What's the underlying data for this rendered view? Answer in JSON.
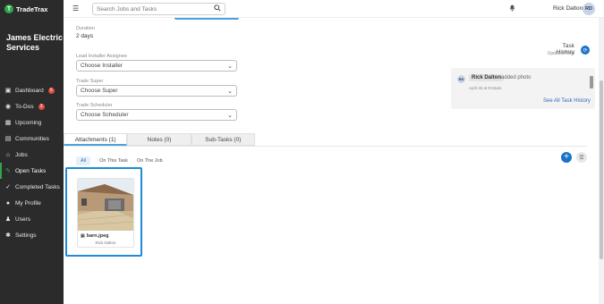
{
  "app": {
    "name": "TradeTrax",
    "logo_glyph": "T"
  },
  "sidebar": {
    "company": "James Electric Services",
    "items": [
      {
        "label": "Dashboard",
        "icon": "dashboard-icon",
        "glyph": "▣",
        "badge": "5",
        "active": false
      },
      {
        "label": "To-Dos",
        "icon": "todo-icon",
        "glyph": "◉",
        "badge": "3",
        "active": false
      },
      {
        "label": "Upcoming",
        "icon": "calendar-icon",
        "glyph": "▦",
        "badge": "",
        "active": false
      },
      {
        "label": "Communities",
        "icon": "communities-icon",
        "glyph": "▤",
        "badge": "",
        "active": false
      },
      {
        "label": "Jobs",
        "icon": "home-icon",
        "glyph": "⌂",
        "badge": "",
        "active": false
      },
      {
        "label": "Open Tasks",
        "icon": "wrench-icon",
        "glyph": "✎",
        "badge": "",
        "active": true
      },
      {
        "label": "Completed Tasks",
        "icon": "check-icon",
        "glyph": "✓",
        "badge": "",
        "active": false
      },
      {
        "label": "My Profile",
        "icon": "profile-icon",
        "glyph": "●",
        "badge": "",
        "active": false
      },
      {
        "label": "Users",
        "icon": "users-icon",
        "glyph": "♟",
        "badge": "",
        "active": false
      },
      {
        "label": "Settings",
        "icon": "gear-icon",
        "glyph": "✱",
        "badge": "",
        "active": false
      }
    ]
  },
  "topbar": {
    "search_placeholder": "Search Jobs and Tasks",
    "user_name": "Rick Dalton",
    "user_initials": "RD"
  },
  "task": {
    "duration_label": "Duration",
    "duration_value": "2 days",
    "installer_label": "Lead Installer Assignee",
    "installer_value": "Choose Installer",
    "super_label": "Trade Super",
    "super_value": "Choose Super",
    "scheduler_label": "Trade Scheduler",
    "scheduler_value": "Choose Scheduler"
  },
  "history": {
    "title": "Task History",
    "subtitle": "Updated Now",
    "entry_initials": "RD",
    "entry_name": "Rick Dalton",
    "entry_action": "added photo",
    "entry_time": "April 25 at 9:53am",
    "see_all": "See All Task History"
  },
  "tabs": [
    {
      "label": "Attachments (1)",
      "active": true
    },
    {
      "label": "Notes (0)",
      "active": false
    },
    {
      "label": "Sub-Tasks (0)",
      "active": false
    }
  ],
  "filters": [
    {
      "label": "All",
      "active": true
    },
    {
      "label": "On This Task",
      "active": false
    },
    {
      "label": "On The Job",
      "active": false
    }
  ],
  "attachments": [
    {
      "filename": "barn.jpeg",
      "uploader": "Rick Dalton"
    }
  ],
  "colors": {
    "accent": "#1a73c8",
    "brand_green": "#2ea84f",
    "sidebar_bg": "#2b2b2b",
    "selection": "#1d8bd6"
  }
}
